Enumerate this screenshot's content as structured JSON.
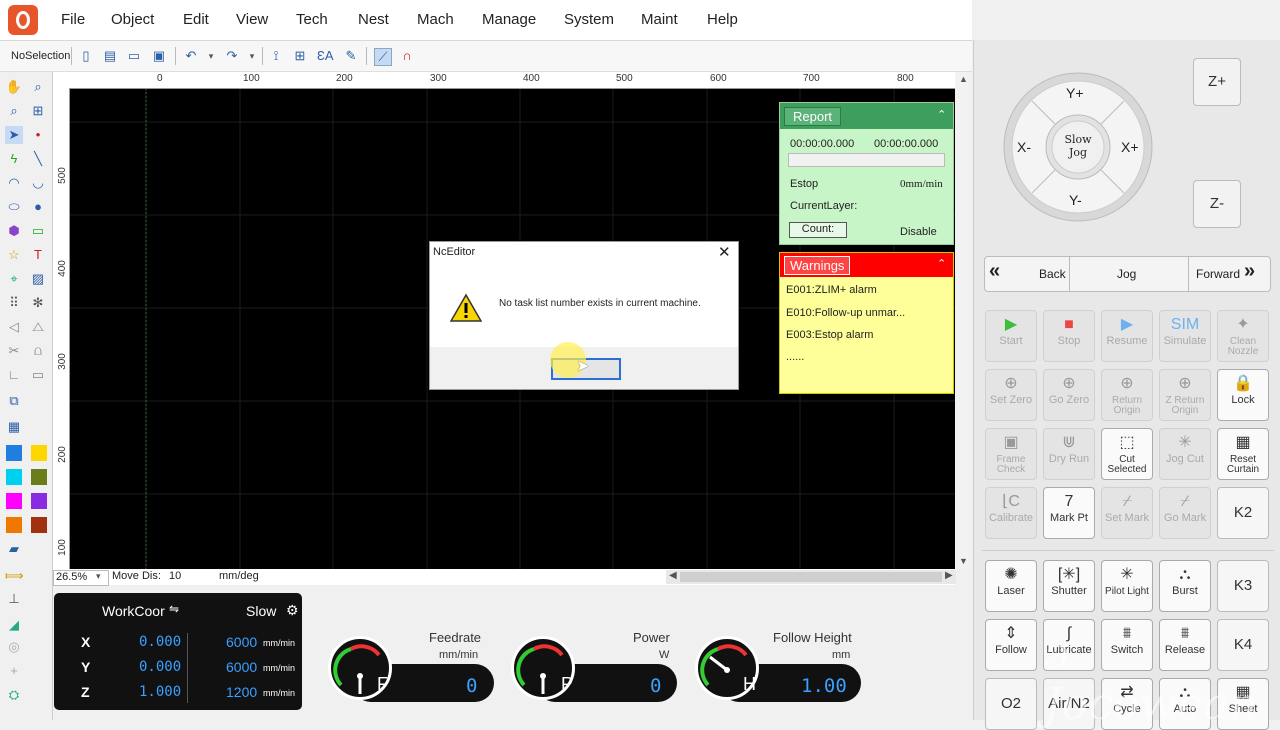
{
  "menu": [
    "File",
    "Object",
    "Edit",
    "View",
    "Tech",
    "Nest",
    "Mach",
    "Manage",
    "System",
    "Maint",
    "Help"
  ],
  "toolbar": {
    "selection": "NoSelection"
  },
  "ruler": {
    "h": [
      "0",
      "100",
      "200",
      "300",
      "400",
      "500",
      "600",
      "700",
      "800"
    ],
    "v": [
      "500",
      "400",
      "300",
      "200",
      "100"
    ]
  },
  "status": {
    "zoom": "26.5%",
    "move_label": "Move Dis:",
    "move_value": "10",
    "unit": "mm/deg"
  },
  "report": {
    "title": "Report",
    "time1": "00:00:00.000",
    "time2": "00:00:00.000",
    "progress": 0,
    "estop": "Estop",
    "speed": "0mm/min",
    "layer": "CurrentLayer:",
    "count_btn": "Count:",
    "state": "Disable"
  },
  "warnings": {
    "title": "Warnings",
    "items": [
      "E001:ZLIM+ alarm",
      "E010:Follow-up unmar...",
      "E003:Estop alarm",
      "......"
    ]
  },
  "dialog": {
    "title": "NcEditor",
    "message": "No task list number exists in current machine.",
    "ok_label": ""
  },
  "coords": {
    "mode": "WorkCoor",
    "speed_mode": "Slow",
    "rows": [
      {
        "axis": "X",
        "value": "0.000",
        "speed": "6000",
        "unit": "mm/min"
      },
      {
        "axis": "Y",
        "value": "0.000",
        "speed": "6000",
        "unit": "mm/min"
      },
      {
        "axis": "Z",
        "value": "1.000",
        "speed": "1200",
        "unit": "mm/min"
      }
    ]
  },
  "gauges": [
    {
      "letter": "F",
      "value": "0",
      "label": "Feedrate",
      "unit": "mm/min"
    },
    {
      "letter": "P",
      "value": "0",
      "label": "Power",
      "unit": "W"
    },
    {
      "letter": "H",
      "value": "1.00",
      "label": "Follow Height",
      "unit": "mm"
    }
  ],
  "jog": {
    "yplus": "Y+",
    "yminus": "Y-",
    "xplus": "X+",
    "xminus": "X-",
    "center": "Slow Jog",
    "zplus": "Z+",
    "zminus": "Z-"
  },
  "nav": {
    "back": "Back",
    "jog": "Jog",
    "forward": "Forward"
  },
  "control_buttons": [
    {
      "label": "Start",
      "icon": "▶"
    },
    {
      "label": "Stop",
      "icon": "■"
    },
    {
      "label": "Resume",
      "icon": "▶"
    },
    {
      "label": "Simulate",
      "icon": "SIM"
    },
    {
      "label": "Clean Nozzle",
      "icon": "✦"
    },
    {
      "label": "Set Zero",
      "icon": "⊕"
    },
    {
      "label": "Go Zero",
      "icon": "⊕"
    },
    {
      "label": "Return Origin",
      "icon": "⊕"
    },
    {
      "label": "Z Return Origin",
      "icon": "⊕"
    },
    {
      "label": "Lock",
      "icon": "🔒"
    },
    {
      "label": "Frame Check",
      "icon": "▣"
    },
    {
      "label": "Dry Run",
      "icon": "⋓"
    },
    {
      "label": "Cut Selected",
      "icon": "⬚"
    },
    {
      "label": "Jog Cut",
      "icon": "✳"
    },
    {
      "label": "Reset Curtain",
      "icon": "▦"
    },
    {
      "label": "Calibrate",
      "icon": "⌊C"
    },
    {
      "label": "Mark Pt",
      "icon": "7"
    },
    {
      "label": "Set Mark",
      "icon": "⌿"
    },
    {
      "label": "Go Mark",
      "icon": "⌿"
    },
    {
      "label": "K2",
      "icon": ""
    }
  ],
  "laser_buttons": [
    {
      "label": "Laser",
      "icon": "✺"
    },
    {
      "label": "Shutter",
      "icon": "[✳]"
    },
    {
      "label": "Pilot Light",
      "icon": "✳"
    },
    {
      "label": "Burst",
      "icon": "⛬"
    },
    {
      "label": "K3",
      "icon": ""
    },
    {
      "label": "Follow",
      "icon": "⇕"
    },
    {
      "label": "Lubricate",
      "icon": "∫"
    },
    {
      "label": "Switch",
      "icon": "⩩"
    },
    {
      "label": "Release",
      "icon": "⩩"
    },
    {
      "label": "K4",
      "icon": ""
    },
    {
      "label": "O2",
      "icon": ""
    },
    {
      "label": "Air/N2",
      "icon": ""
    },
    {
      "label": "Cycle",
      "icon": "⇄"
    },
    {
      "label": "Auto",
      "icon": "⛬"
    },
    {
      "label": "Sheet",
      "icon": "▦"
    }
  ],
  "colors": {
    "report_header": "#3d9e5e",
    "warning_header": "#ff0000",
    "canvas": "#000000",
    "value_blue": "#3aa0ff"
  }
}
